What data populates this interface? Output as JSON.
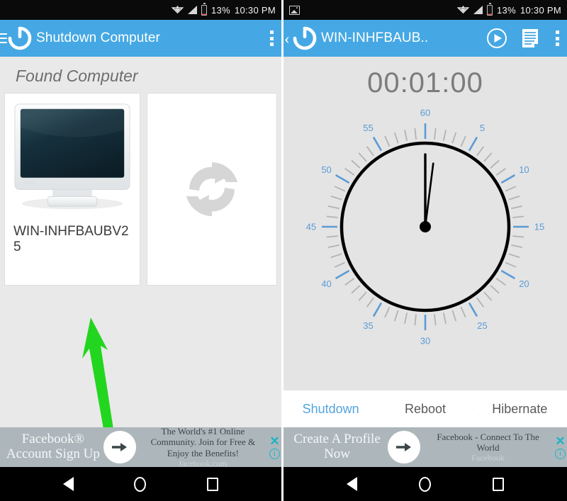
{
  "colors": {
    "toolbar_blue": "#45a8e4",
    "accent_blue": "#54a4de",
    "tick_blue": "#5b9bd5",
    "page_bg": "#e8e8e8",
    "annotation_green": "#22d61f",
    "battery_red": "#e04b3d",
    "ad_bg": "#adb7bb",
    "ad_accent": "#1ab3c8"
  },
  "status_bar": {
    "battery_percent": "13%",
    "time": "10:30 PM",
    "icons_left_screen": [
      "wifi-icon",
      "signal-icon",
      "battery-icon"
    ],
    "icons_right_screen": [
      "image-icon",
      "wifi-icon",
      "signal-icon",
      "battery-icon"
    ]
  },
  "left_screen": {
    "toolbar": {
      "menu_icon": "hamburger-menu-icon",
      "app_icon": "power-icon",
      "title": "Shutdown Computer",
      "overflow_icon": "kebab-menu-icon"
    },
    "section_title": "Found Computer",
    "computer_card": {
      "icon": "desktop-monitor-icon",
      "name": "WIN-INHFBAUBV25"
    },
    "refresh_card": {
      "icon": "refresh-sync-icon"
    },
    "annotation": {
      "type": "arrow",
      "color": "#22d61f",
      "points_to": "WIN-INHFBAUBV25"
    },
    "ad": {
      "headline": "Facebook® Account Sign Up",
      "body": "The World's #1 Online Community. Join for Free & Enjoy the Benefits!",
      "source": "facebook.com",
      "cta_icon": "arrow-right-icon",
      "close_label": "✕",
      "info_label": "i"
    }
  },
  "right_screen": {
    "toolbar": {
      "back_icon": "back-chevron-icon",
      "app_icon": "power-icon",
      "title": "WIN-INHFBAUB..",
      "play_icon": "play-circle-icon",
      "log_icon": "log-document-icon",
      "overflow_icon": "kebab-menu-icon"
    },
    "timer": "00:01:00",
    "clock": {
      "labels": [
        "60",
        "5",
        "10",
        "15",
        "20",
        "25",
        "30",
        "35",
        "40",
        "45",
        "50",
        "55"
      ],
      "minute_hand_value": 60,
      "second_hand_value": 0.3,
      "total_minor_ticks": 60
    },
    "tabs": [
      {
        "label": "Shutdown",
        "active": true
      },
      {
        "label": "Reboot",
        "active": false
      },
      {
        "label": "Hibernate",
        "active": false
      }
    ],
    "ad": {
      "headline": "Create A Profile Now",
      "body": "Facebook - Connect To The World",
      "source": "Facebook",
      "cta_icon": "arrow-right-icon",
      "close_label": "✕",
      "info_label": "i"
    }
  },
  "nav_bar": {
    "back": "back-triangle-icon",
    "home": "home-circle-icon",
    "recents": "recents-square-icon"
  }
}
